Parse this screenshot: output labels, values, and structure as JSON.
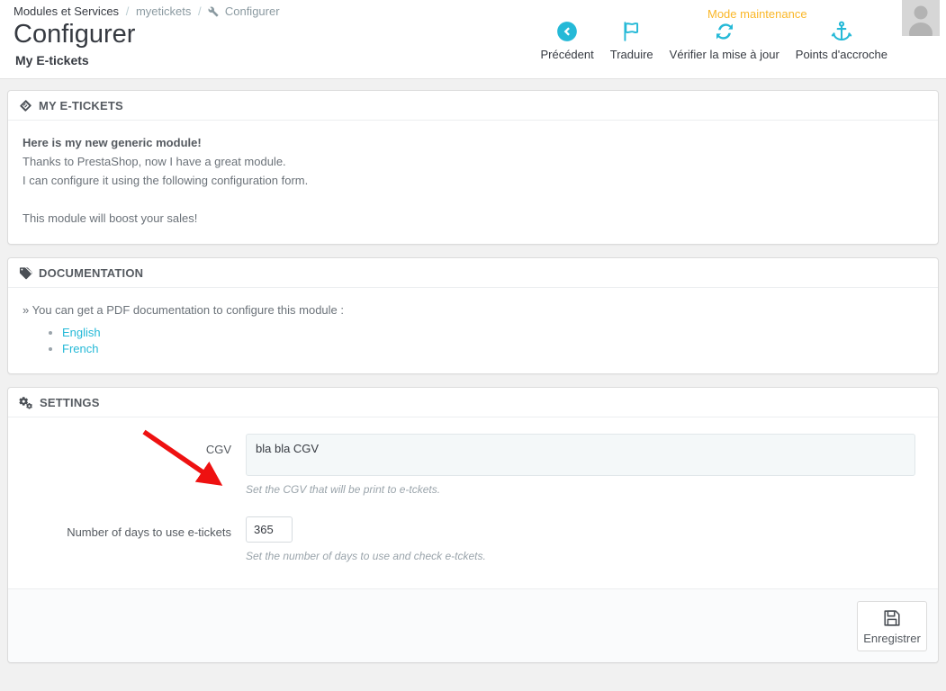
{
  "header": {
    "breadcrumb": {
      "root": "Modules et Services",
      "separator": "/",
      "module": "myetickets",
      "current": "Configurer",
      "current_icon": "wrench-icon"
    },
    "title": "Configurer",
    "subtitle": "My E-tickets",
    "maintenance_label": "Mode maintenance",
    "accent_color": "#25b9d7",
    "maintenance_color": "#fab728",
    "toolbar": [
      {
        "label": "Précédent",
        "icon": "arrow-circle-left-icon"
      },
      {
        "label": "Traduire",
        "icon": "flag-icon"
      },
      {
        "label": "Vérifier la mise à jour",
        "icon": "refresh-icon"
      },
      {
        "label": "Points d'accroche",
        "icon": "anchor-icon"
      }
    ],
    "avatar_alt": "avatar"
  },
  "panels": {
    "etickets": {
      "heading": "MY E-TICKETS",
      "heading_icon": "ticket-icon",
      "line1": "Here is my new generic module!",
      "line2": "Thanks to PrestaShop, now I have a great module.",
      "line3": "I can configure it using the following configuration form.",
      "line4": "This module will boost your sales!"
    },
    "documentation": {
      "heading": "DOCUMENTATION",
      "heading_icon": "tag-icon",
      "intro": "» You can get a PDF documentation to configure this module :",
      "links": [
        {
          "label": "English"
        },
        {
          "label": "French"
        }
      ],
      "link_color": "#25b9d7"
    },
    "settings": {
      "heading": "SETTINGS",
      "heading_icon": "cogs-icon",
      "fields": [
        {
          "label": "CGV",
          "value": "bla bla CGV",
          "help": "Set the CGV that will be print to e-tckets.",
          "type": "textarea"
        },
        {
          "label": "Number of days to use e-tickets",
          "value": "365",
          "help": "Set the number of days to use and check e-tckets.",
          "type": "number"
        }
      ],
      "save_label": "Enregistrer",
      "save_icon": "floppy-save-icon"
    }
  },
  "annotation": {
    "arrow_color": "#ee1111",
    "arrow_target": "CGV"
  }
}
